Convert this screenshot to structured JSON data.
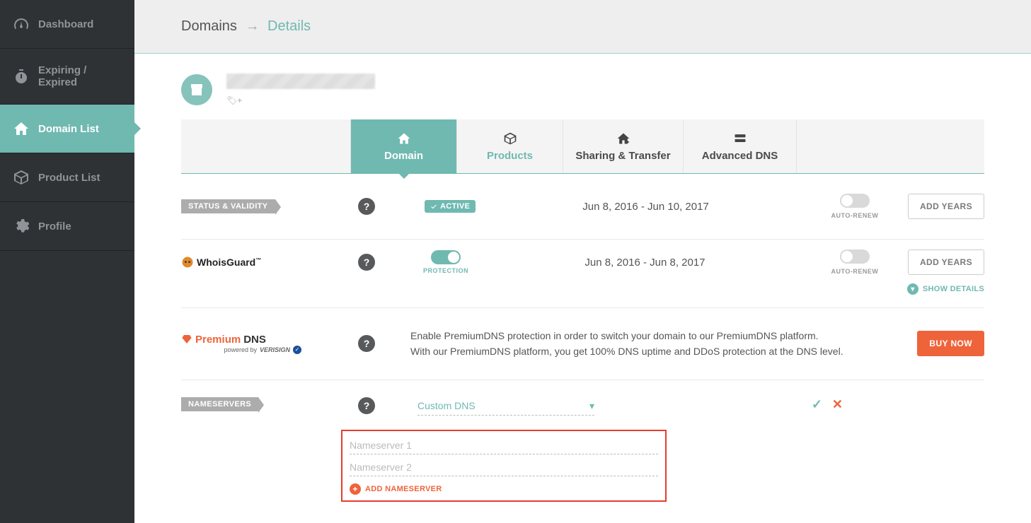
{
  "sidebar": {
    "items": [
      {
        "label": "Dashboard"
      },
      {
        "label": "Expiring / Expired"
      },
      {
        "label": "Domain List"
      },
      {
        "label": "Product List"
      },
      {
        "label": "Profile"
      }
    ]
  },
  "breadcrumb": {
    "root": "Domains",
    "arrow": "→",
    "current": "Details"
  },
  "tabs": {
    "domain": "Domain",
    "products": "Products",
    "sharing": "Sharing & Transfer",
    "advanced": "Advanced DNS"
  },
  "status": {
    "section_label": "STATUS & VALIDITY",
    "badge": "ACTIVE",
    "dates": "Jun 8, 2016 - Jun 10, 2017",
    "auto_renew_label": "AUTO-RENEW",
    "add_years": "ADD YEARS"
  },
  "whois": {
    "brand_prefix": "Whois",
    "brand_suffix": "Guard",
    "tm": "™",
    "protection_label": "PROTECTION",
    "dates": "Jun 8, 2016 - Jun 8, 2017",
    "auto_renew_label": "AUTO-RENEW",
    "add_years": "ADD YEARS",
    "show_details": "SHOW DETAILS"
  },
  "premium": {
    "name1": "Premium",
    "name2": "DNS",
    "powered_by": "powered by",
    "verisign": "VERISIGN",
    "line1": "Enable PremiumDNS protection in order to switch your domain to our PremiumDNS platform.",
    "line2": "With our PremiumDNS platform, you get 100% DNS uptime and DDoS protection at the DNS level.",
    "buy_now": "BUY NOW"
  },
  "nameservers": {
    "section_label": "NAMESERVERS",
    "selected": "Custom DNS",
    "ph1": "Nameserver 1",
    "ph2": "Nameserver 2",
    "add": "ADD NAMESERVER"
  },
  "icons": {
    "help": "?"
  }
}
